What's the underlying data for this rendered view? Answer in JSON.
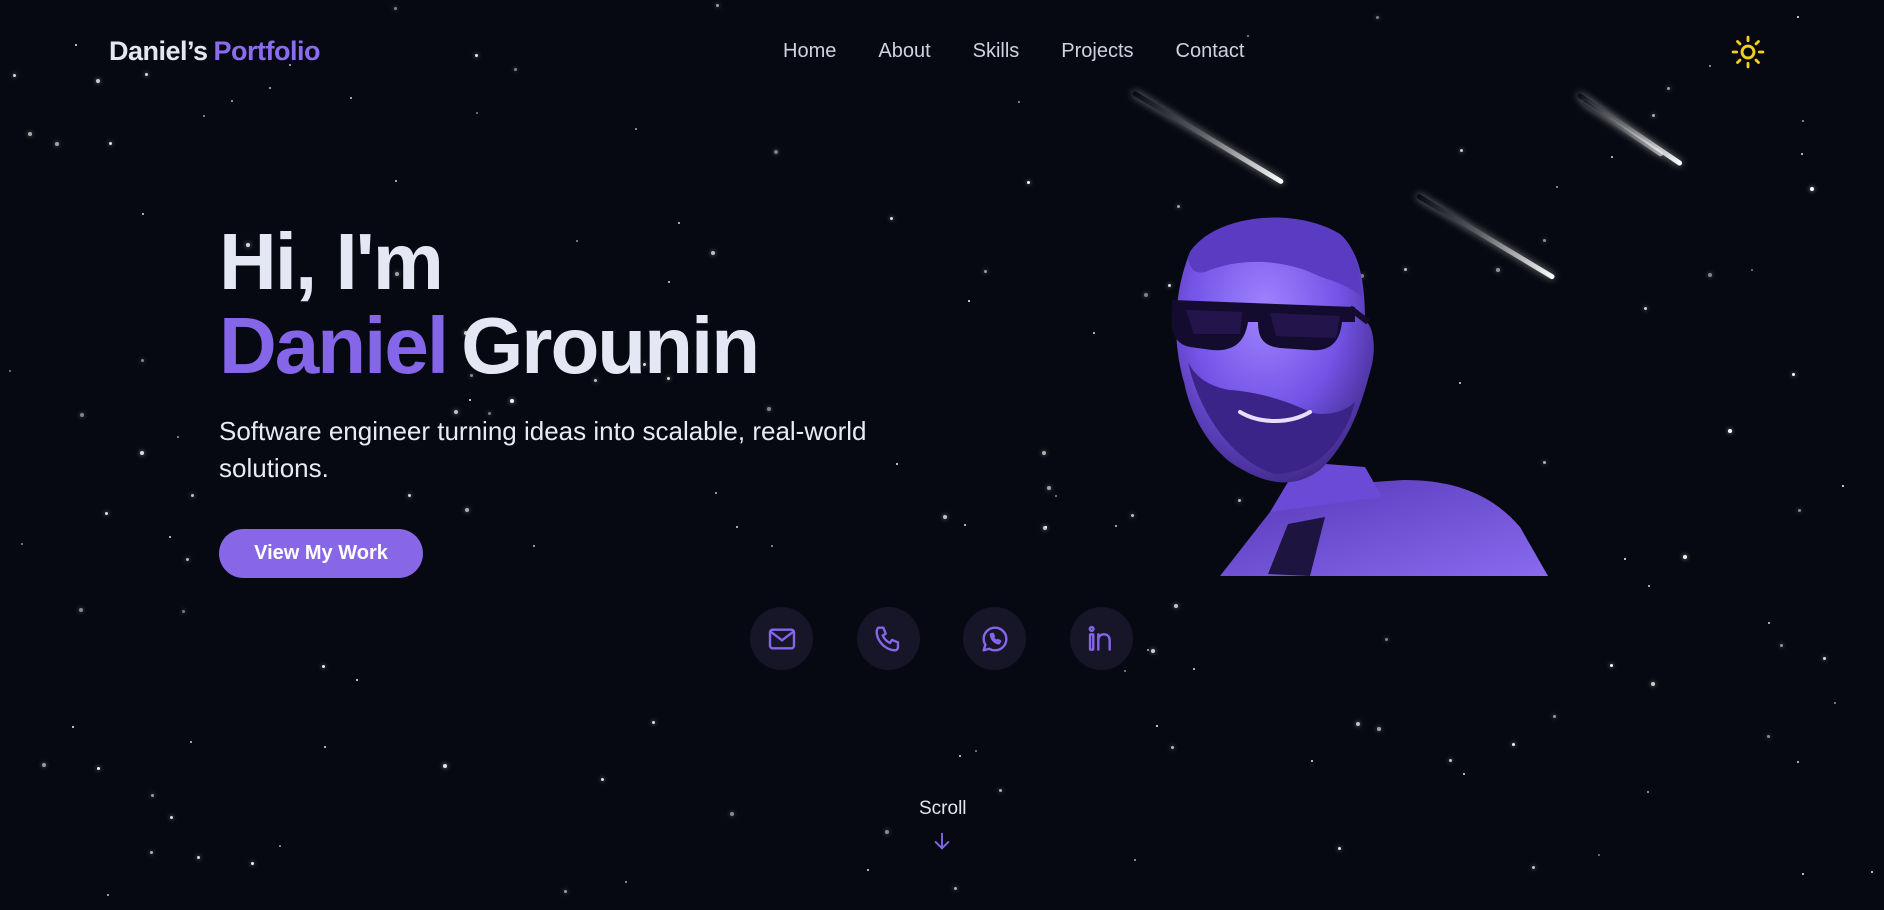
{
  "header": {
    "brand_name": "Daniel’s",
    "brand_accent": "Portfolio",
    "nav": [
      "Home",
      "About",
      "Skills",
      "Projects",
      "Contact"
    ],
    "theme_icon": "sun-icon"
  },
  "hero": {
    "greeting": "Hi, I'm",
    "first_name": "Daniel",
    "last_name": "Grounin",
    "tagline": "Software engineer turning ideas into scalable, real-world solutions.",
    "cta_label": "View My Work"
  },
  "socials": [
    {
      "icon": "mail-icon"
    },
    {
      "icon": "phone-icon"
    },
    {
      "icon": "whatsapp-icon"
    },
    {
      "icon": "linkedin-icon"
    }
  ],
  "scroll": {
    "label": "Scroll",
    "icon": "arrow-down-icon"
  },
  "colors": {
    "background": "#070912",
    "accent": "#8767e6",
    "text": "#e4e8f4",
    "sun": "#f2cf1d",
    "social_bg": "#161628"
  }
}
